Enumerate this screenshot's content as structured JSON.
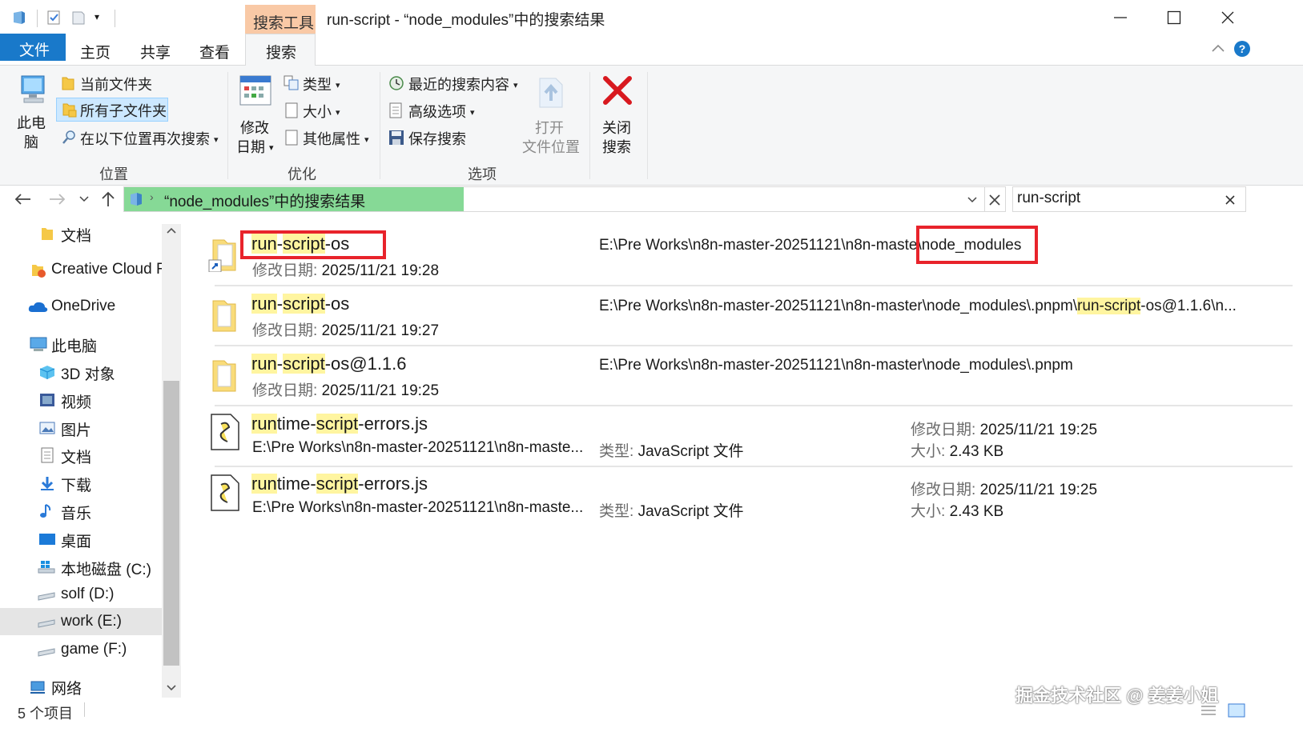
{
  "titlebar": {
    "context_tab": "搜索工具",
    "window_title": "run-script - “node_modules”中的搜索结果",
    "minimize": "—",
    "maximize": "☐",
    "close": "✕"
  },
  "ribbon_tabs": [
    {
      "label": "文件"
    },
    {
      "label": "主页"
    },
    {
      "label": "共享"
    },
    {
      "label": "查看"
    },
    {
      "label": "搜索"
    }
  ],
  "ribbon": {
    "location": {
      "this_pc_line1": "此电",
      "this_pc_line2": "脑",
      "current_folder": "当前文件夹",
      "all_subfolders": "所有子文件夹",
      "search_again": "在以下位置再次搜索",
      "label": "位置"
    },
    "refine": {
      "modified_line1": "修改",
      "modified_line2": "日期",
      "kind": "类型",
      "size": "大小",
      "other_props": "其他属性",
      "label": "优化"
    },
    "options": {
      "recent": "最近的搜索内容",
      "advanced": "高级选项",
      "save": "保存搜索",
      "open_line1": "打开",
      "open_line2": "文件位置",
      "label": "选项"
    },
    "close_search_line1": "关闭",
    "close_search_line2": "搜索"
  },
  "address": {
    "path": "“node_modules”中的搜索结果",
    "search_value": "run-script"
  },
  "sidebar": {
    "items": [
      {
        "label": "文档"
      },
      {
        "label": "Creative Cloud Fi"
      },
      {
        "label": "OneDrive"
      },
      {
        "label": "此电脑"
      },
      {
        "label": "3D 对象"
      },
      {
        "label": "视频"
      },
      {
        "label": "图片"
      },
      {
        "label": "文档"
      },
      {
        "label": "下载"
      },
      {
        "label": "音乐"
      },
      {
        "label": "桌面"
      },
      {
        "label": "本地磁盘 (C:)"
      },
      {
        "label": "solf (D:)"
      },
      {
        "label": "work (E:)"
      },
      {
        "label": "game (F:)"
      },
      {
        "label": "网络"
      }
    ]
  },
  "results": [
    {
      "name_parts": [
        "run",
        "-",
        "script",
        "-os"
      ],
      "date_label": "修改日期:",
      "date": "2025/11/21 19:28",
      "path_a": "E:\\Pre Works\\n8n-master-20251121\\n8n-maste",
      "path_b": "\\node_modules"
    },
    {
      "name_parts": [
        "run",
        "-",
        "script",
        "-os"
      ],
      "date_label": "修改日期:",
      "date": "2025/11/21 19:27",
      "path_a": "E:\\Pre Works\\n8n-master-20251121\\n8n-master\\node_modules\\.pnpm\\",
      "path_hl": "run-script",
      "path_b": "-os@1.1.6\\n..."
    },
    {
      "name_parts": [
        "run",
        "-",
        "script",
        "-os@1.1.6"
      ],
      "date_label": "修改日期:",
      "date": "2025/11/21 19:25",
      "path": "E:\\Pre Works\\n8n-master-20251121\\n8n-master\\node_modules\\.pnpm"
    },
    {
      "name_parts": [
        "run",
        "time-",
        "script",
        "-errors.js"
      ],
      "path": "E:\\Pre Works\\n8n-master-20251121\\n8n-maste...",
      "type_label": "类型:",
      "type": "JavaScript 文件",
      "date_label": "修改日期:",
      "date": "2025/11/21 19:25",
      "size_label": "大小:",
      "size": "2.43 KB"
    },
    {
      "name_parts": [
        "run",
        "time-",
        "script",
        "-errors.js"
      ],
      "path": "E:\\Pre Works\\n8n-master-20251121\\n8n-maste...",
      "type_label": "类型:",
      "type": "JavaScript 文件",
      "date_label": "修改日期:",
      "date": "2025/11/21 19:25",
      "size_label": "大小:",
      "size": "2.43 KB"
    }
  ],
  "status": {
    "count": "5 个项目"
  },
  "watermark": "掘金技术社区 @ 姜姜小姐",
  "colors": {
    "file_tab": "#1979ca",
    "context_tab": "#f9c9a6",
    "address_green": "#86d996",
    "highlight": "#fff5a0",
    "annotation_red": "#e8232b",
    "selection_blue": "#cce8ff"
  }
}
